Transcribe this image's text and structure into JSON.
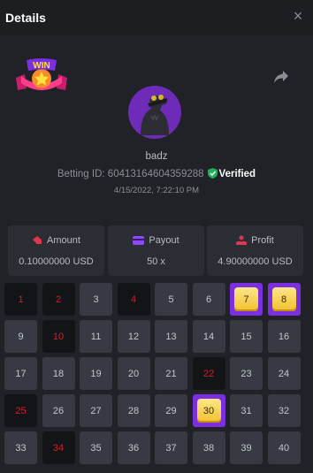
{
  "header": {
    "title": "Details",
    "close_label": "×"
  },
  "badge": {
    "text": "WIN"
  },
  "user": {
    "name": "badz",
    "betting_label": "Betting ID:",
    "betting_id": "60413164604359288",
    "verified": "Verified",
    "date": "4/15/2022, 7:22:10 PM"
  },
  "stats": [
    {
      "label": "Amount",
      "value": "0.10000000 USD",
      "icon": "coins-icon"
    },
    {
      "label": "Payout",
      "value": "50 x",
      "icon": "card-icon"
    },
    {
      "label": "Profit",
      "value": "4.90000000 USD",
      "icon": "hand-coins-icon"
    }
  ],
  "tiles": [
    {
      "n": "1",
      "s": "miss"
    },
    {
      "n": "2",
      "s": "miss"
    },
    {
      "n": "3",
      "s": "plain"
    },
    {
      "n": "4",
      "s": "miss"
    },
    {
      "n": "5",
      "s": "plain"
    },
    {
      "n": "6",
      "s": "plain"
    },
    {
      "n": "7",
      "s": "hit"
    },
    {
      "n": "8",
      "s": "hit"
    },
    {
      "n": "9",
      "s": "plain"
    },
    {
      "n": "10",
      "s": "miss"
    },
    {
      "n": "11",
      "s": "plain"
    },
    {
      "n": "12",
      "s": "plain"
    },
    {
      "n": "13",
      "s": "plain"
    },
    {
      "n": "14",
      "s": "plain"
    },
    {
      "n": "15",
      "s": "plain"
    },
    {
      "n": "16",
      "s": "plain"
    },
    {
      "n": "17",
      "s": "plain"
    },
    {
      "n": "18",
      "s": "plain"
    },
    {
      "n": "19",
      "s": "plain"
    },
    {
      "n": "20",
      "s": "plain"
    },
    {
      "n": "21",
      "s": "plain"
    },
    {
      "n": "22",
      "s": "miss"
    },
    {
      "n": "23",
      "s": "plain"
    },
    {
      "n": "24",
      "s": "plain"
    },
    {
      "n": "25",
      "s": "miss"
    },
    {
      "n": "26",
      "s": "plain"
    },
    {
      "n": "27",
      "s": "plain"
    },
    {
      "n": "28",
      "s": "plain"
    },
    {
      "n": "29",
      "s": "plain"
    },
    {
      "n": "30",
      "s": "hit"
    },
    {
      "n": "31",
      "s": "plain"
    },
    {
      "n": "32",
      "s": "plain"
    },
    {
      "n": "33",
      "s": "plain"
    },
    {
      "n": "34",
      "s": "miss"
    },
    {
      "n": "35",
      "s": "plain"
    },
    {
      "n": "36",
      "s": "plain"
    },
    {
      "n": "37",
      "s": "plain"
    },
    {
      "n": "38",
      "s": "plain"
    },
    {
      "n": "39",
      "s": "plain"
    },
    {
      "n": "40",
      "s": "plain"
    }
  ],
  "colors": {
    "hit": "#7b2fe0",
    "miss_text": "#d11f2a",
    "verified_shield": "#1fb05a"
  }
}
